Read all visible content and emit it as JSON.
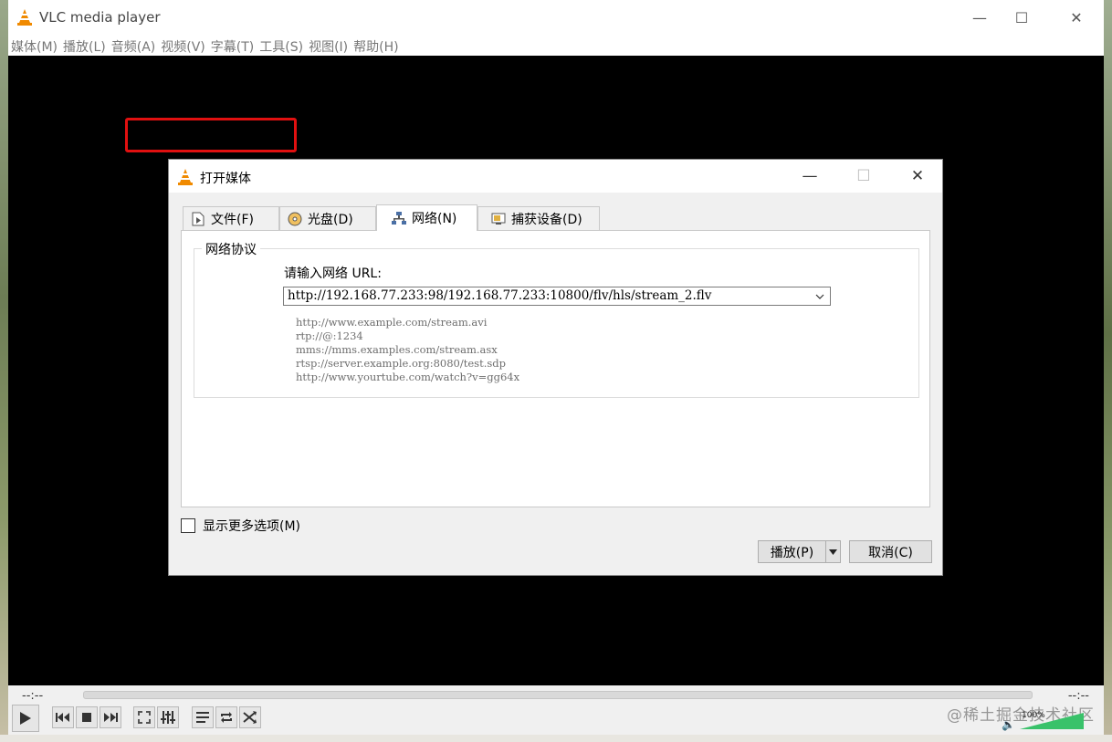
{
  "window": {
    "title": "VLC media player",
    "minimize_glyph": "—",
    "maximize_glyph": "☐",
    "close_glyph": "✕"
  },
  "menu": [
    {
      "label": "媒体(M)"
    },
    {
      "label": "播放(L)"
    },
    {
      "label": "音频(A)"
    },
    {
      "label": "视频(V)"
    },
    {
      "label": "字幕(T)"
    },
    {
      "label": "工具(S)"
    },
    {
      "label": "视图(I)"
    },
    {
      "label": "帮助(H)"
    }
  ],
  "controls": {
    "time_elapsed": "--:--",
    "time_total": "--:--",
    "volume_label": "100%",
    "volume_level": 1.0
  },
  "watermark": "@稀土掘金技术社区",
  "dialog": {
    "title": "打开媒体",
    "tabs": [
      {
        "label": "文件(F)",
        "icon": "file-play-icon"
      },
      {
        "label": "光盘(D)",
        "icon": "disc-icon"
      },
      {
        "label": "网络(N)",
        "icon": "network-icon",
        "active": true
      },
      {
        "label": "捕获设备(D)",
        "icon": "capture-device-icon"
      }
    ],
    "group_title": "网络协议",
    "url_label": "请输入网络 URL:",
    "url_value": "http://192.168.77.233:98/192.168.77.233:10800/flv/hls/stream_2.flv",
    "examples": [
      "http://www.example.com/stream.avi",
      "rtp://@:1234",
      "mms://mms.examples.com/stream.asx",
      "rtsp://server.example.org:8080/test.sdp",
      "http://www.yourtube.com/watch?v=gg64x"
    ],
    "show_more_options": "显示更多选项(M)",
    "play_button": "播放(P)",
    "cancel_button": "取消(C)",
    "annotation_color": "#e01010"
  },
  "colors": {
    "vlc_orange": "#f08a00",
    "video_bg": "#000000"
  }
}
